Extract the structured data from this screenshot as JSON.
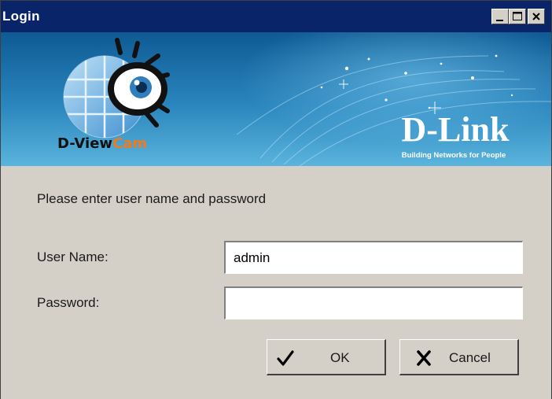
{
  "window": {
    "title": "Login",
    "controls": {
      "minimize_icon": "minimize-icon",
      "maximize_icon": "maximize-icon",
      "close_icon": "close-icon"
    }
  },
  "banner": {
    "product_logo": {
      "part1": "D-View",
      "part2": "Cam",
      "part1_color": "#111111",
      "part2_color": "#f07a1c"
    },
    "brand_logo": {
      "name": "D-Link",
      "tagline": "Building Networks for People",
      "color": "#ffffff"
    },
    "colors": {
      "top": "#0e5a94",
      "bottom": "#5ab4dc"
    }
  },
  "form": {
    "prompt": "Please enter user name and password",
    "username": {
      "label": "User Name:",
      "value": "admin"
    },
    "password": {
      "label": "Password:",
      "value": ""
    }
  },
  "buttons": {
    "ok": {
      "label": "OK",
      "icon": "checkmark-icon"
    },
    "cancel": {
      "label": "Cancel",
      "icon": "x-cross-icon"
    }
  }
}
